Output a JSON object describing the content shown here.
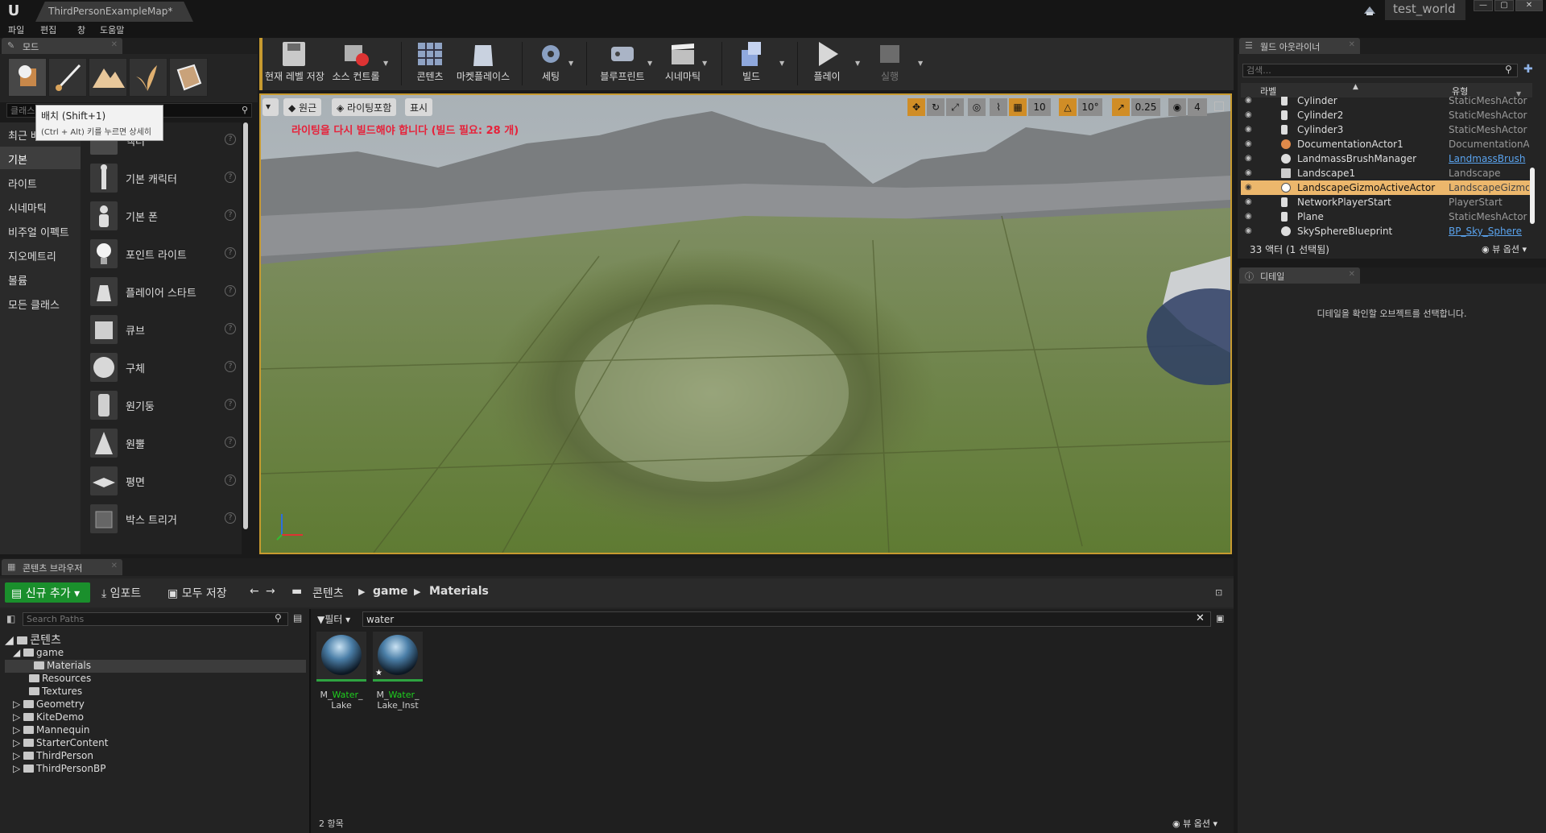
{
  "title_bar": {
    "logo": "U",
    "doc_tab": "ThirdPersonExampleMap*",
    "project_name": "test_world"
  },
  "menu": [
    "파일",
    "편집",
    "창",
    "도움말"
  ],
  "modes": {
    "tab_label": "모드",
    "search_placeholder": "클래스 검색",
    "categories": [
      "최근 배치",
      "기본",
      "라이트",
      "시네마틱",
      "비주얼 이펙트",
      "지오메트리",
      "볼륨",
      "모든 클래스"
    ],
    "active_category": "기본",
    "items": [
      "액터",
      "기본 캐릭터",
      "기본 폰",
      "포인트 라이트",
      "플레이어 스타트",
      "큐브",
      "구체",
      "원기둥",
      "원뿔",
      "평면",
      "박스 트리거"
    ],
    "tooltip_title": "배치 (Shift+1)",
    "tooltip_body": "(Ctrl + Alt) 키를 누르면 상세히"
  },
  "toolbar": {
    "buttons": [
      {
        "label": "현재 레벨 저장",
        "icon": "save-icon",
        "color": "#c9c9c9"
      },
      {
        "label": "소스 컨트롤",
        "icon": "source-control-icon",
        "color": "#b0b0b0"
      },
      {
        "label": "콘텐츠",
        "icon": "content-icon",
        "color": "#8fa3c4"
      },
      {
        "label": "마켓플레이스",
        "icon": "marketplace-icon",
        "color": "#c9d2e0"
      },
      {
        "label": "세팅",
        "icon": "settings-icon",
        "color": "#8aa0c2"
      },
      {
        "label": "블루프린트",
        "icon": "blueprint-icon",
        "color": "#aab4c6"
      },
      {
        "label": "시네마틱",
        "icon": "cinematic-icon",
        "color": "#c0c0c0"
      },
      {
        "label": "빌드",
        "icon": "build-icon",
        "color": "#8fa8dd"
      },
      {
        "label": "플레이",
        "icon": "play-icon",
        "color": "#d7d7d7"
      },
      {
        "label": "실행",
        "icon": "launch-icon",
        "color": "#6c6c6c"
      }
    ]
  },
  "viewport": {
    "perspective": "원근",
    "view_mode": "라이팅포함",
    "show": "표시",
    "warning": "라이팅을 다시 빌드해야 합니다 (빌드 필요: 28 개)",
    "grid_snap": "10",
    "rotation_snap": "10°",
    "scale_snap": "0.25",
    "camera_speed": "4"
  },
  "outliner": {
    "tab_label": "월드 아웃라이너",
    "search_placeholder": "검색...",
    "col_label": "라벨",
    "col_type": "유형",
    "rows": [
      {
        "name": "Cylinder",
        "type": "StaticMeshActor"
      },
      {
        "name": "Cylinder2",
        "type": "StaticMeshActor"
      },
      {
        "name": "Cylinder3",
        "type": "StaticMeshActor"
      },
      {
        "name": "DocumentationActor1",
        "type": "DocumentationAc"
      },
      {
        "name": "LandmassBrushManager",
        "type": "LandmassBrush"
      },
      {
        "name": "Landscape1",
        "type": "Landscape"
      },
      {
        "name": "LandscapeGizmoActiveActor",
        "type": "LandscapeGizmo"
      },
      {
        "name": "NetworkPlayerStart",
        "type": "PlayerStart"
      },
      {
        "name": "Plane",
        "type": "StaticMeshActor"
      },
      {
        "name": "SkySphereBlueprint",
        "type": "BP_Sky_Sphere"
      }
    ],
    "selected_row": "LandscapeGizmoActiveActor",
    "count": "33 액터 (1 선택됨)",
    "view_options": "뷰 옵션"
  },
  "details": {
    "tab_label": "디테일",
    "empty_text": "디테일을 확인할 오브젝트를 선택합니다."
  },
  "content_browser": {
    "tab_label": "콘텐츠 브라우저",
    "add_new": "신규 추가",
    "import": "임포트",
    "save_all": "모두 저장",
    "path": [
      "콘텐츠",
      "game",
      "Materials"
    ],
    "search_paths_placeholder": "Search Paths",
    "filter_label": "필터",
    "search_value": "water",
    "tree": [
      {
        "label": "콘텐츠",
        "level": 0
      },
      {
        "label": "game",
        "level": 1
      },
      {
        "label": "Materials",
        "level": 2
      },
      {
        "label": "Resources",
        "level": 2
      },
      {
        "label": "Textures",
        "level": 2
      },
      {
        "label": "Geometry",
        "level": 1
      },
      {
        "label": "KiteDemo",
        "level": 1
      },
      {
        "label": "Mannequin",
        "level": 1
      },
      {
        "label": "StarterContent",
        "level": 1
      },
      {
        "label": "ThirdPerson",
        "level": 1
      },
      {
        "label": "ThirdPersonBP",
        "level": 1
      }
    ],
    "selected_folder": "Materials",
    "assets": [
      {
        "pre": "M_",
        "hl": "Water",
        "post": "_",
        "line2": "Lake"
      },
      {
        "pre": "M_",
        "hl": "Water",
        "post": "_",
        "line2": "Lake_Inst"
      }
    ],
    "item_count": "2 항목",
    "view_options": "뷰 옵션"
  }
}
